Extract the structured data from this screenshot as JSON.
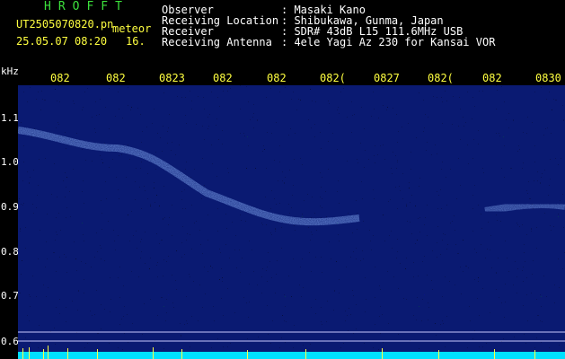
{
  "app_title": "HROFFT",
  "file_name": "UT2505070820.pn",
  "file_tag": "meteor",
  "datetime": "25.05.07 08:20",
  "extra_value": "16.",
  "info": {
    "labels": [
      "Observer",
      "Receiving Location",
      "Receiver",
      "Receiving Antenna"
    ],
    "values": [
      ": Masaki Kano",
      ": Shibukawa, Gunma, Japan",
      ": SDR# 43dB L15 111.6MHz USB",
      ": 4ele Yagi Az 230 for Kansai VOR"
    ]
  },
  "y_axis": {
    "unit": "kHz",
    "ticks": [
      "1.1",
      "1.0",
      "0.9",
      "0.8",
      "0.7",
      "0.6"
    ]
  },
  "x_axis": {
    "ticks": [
      "082",
      "082",
      "0823",
      "082",
      "082",
      "082(",
      "0827",
      "082(",
      "082",
      "0830"
    ]
  },
  "colors": {
    "background": "#000000",
    "spectrogram_bg": "#0a1a72",
    "title_green": "#3ce03c",
    "info_white": "#ffffff",
    "tick_yellow": "#ffff40",
    "bottom_cyan": "#00e0ff"
  }
}
